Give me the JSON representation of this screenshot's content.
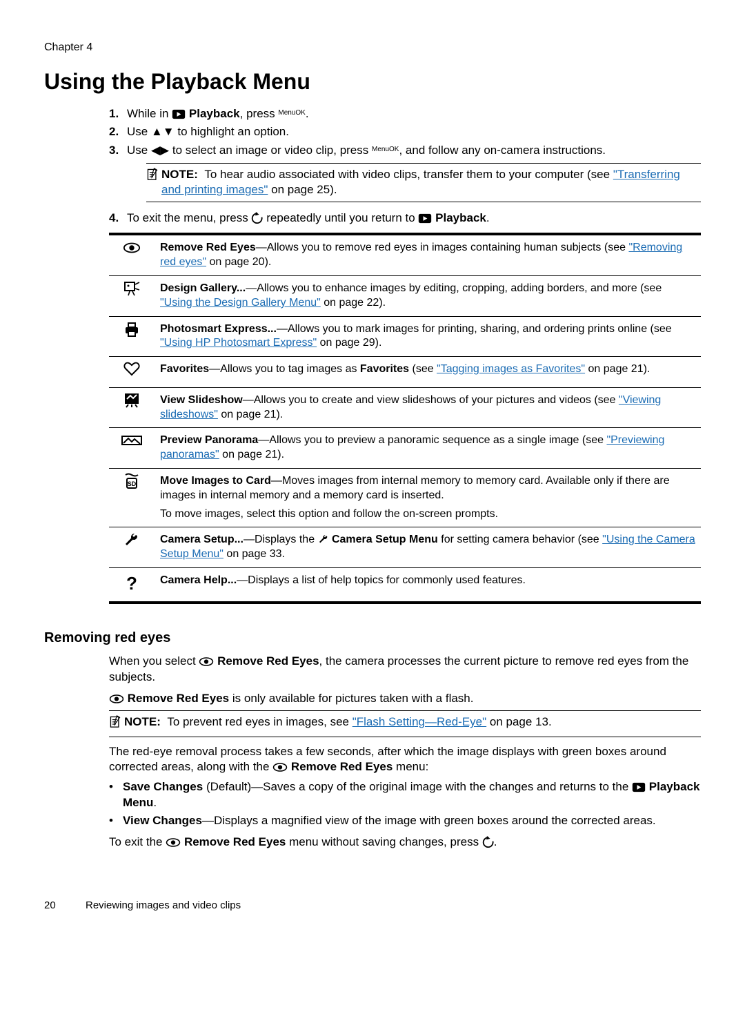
{
  "chapter": "Chapter 4",
  "title": "Using the Playback Menu",
  "steps": [
    {
      "num": "1.",
      "pre": "While in ",
      "icon": "playback-icon",
      "bold": " Playback",
      "post": ", press ",
      "end_icon": "menu-ok",
      "suffix": "."
    },
    {
      "num": "2.",
      "pre": "Use ",
      "icon": "up-down-icon",
      "post": " to highlight an option."
    },
    {
      "num": "3.",
      "pre": "Use ",
      "icon": "left-right-icon",
      "post": " to select an image or video clip, press ",
      "end_icon": "menu-ok",
      "suffix": ", and follow any on-camera instructions."
    }
  ],
  "note1": {
    "label": "NOTE:",
    "text": "To hear audio associated with video clips, transfer them to your computer (see ",
    "link": "\"Transferring and printing images\"",
    "after": " on page 25)."
  },
  "step4": {
    "num": "4.",
    "pre": "To exit the menu, press ",
    "icon": "back-icon",
    "mid": " repeatedly until you return to ",
    "icon2": "playback-icon",
    "bold": " Playback",
    "post": "."
  },
  "rows": [
    {
      "icon": "eye-icon",
      "bold": "Remove Red Eyes",
      "dash": "—Allows you to remove red eyes in images containing human subjects (see ",
      "link": "\"Removing red eyes\"",
      "after": " on page 20)."
    },
    {
      "icon": "design-gallery-icon",
      "bold": "Design Gallery...",
      "dash": "—Allows you to enhance images by editing, cropping, adding borders, and more (see ",
      "link": "\"Using the Design Gallery Menu\"",
      "after": " on page 22)."
    },
    {
      "icon": "photosmart-icon",
      "bold": "Photosmart Express...",
      "dash": "—Allows you to mark images for printing, sharing, and ordering prints online (see ",
      "link": "\"Using HP Photosmart Express\"",
      "after": " on page 29)."
    },
    {
      "icon": "heart-icon",
      "bold": "Favorites",
      "dash": "—Allows you to tag images as ",
      "bold2": "Favorites",
      "mid": " (see ",
      "link": "\"Tagging images as Favorites\"",
      "after": " on page 21)."
    },
    {
      "icon": "slideshow-icon",
      "bold": "View Slideshow",
      "dash": "—Allows you to create and view slideshows of your pictures and videos (see ",
      "link": "\"Viewing slideshows\"",
      "after": " on page 21)."
    },
    {
      "icon": "panorama-icon",
      "bold": "Preview Panorama",
      "dash": "—Allows you to preview a panoramic sequence as a single image (see ",
      "link": "\"Previewing panoramas\"",
      "after": " on page 21)."
    },
    {
      "icon": "sd-card-icon",
      "bold": "Move Images to Card",
      "dash": "—Moves images from internal memory to memory card. Available only if there are images in internal memory and a memory card is inserted.",
      "line2": "To move images, select this option and follow the on-screen prompts."
    },
    {
      "icon": "wrench-icon",
      "bold": "Camera Setup...",
      "dash": "—Displays the ",
      "inline_icon": "wrench-icon",
      "bold2": " Camera Setup Menu",
      "mid": " for setting camera behavior (see ",
      "link": "\"Using the Camera Setup Menu\"",
      "after": " on page 33."
    },
    {
      "icon": "help-icon",
      "bold": "Camera Help...",
      "dash": "—Displays a list of help topics for commonly used features."
    }
  ],
  "sub_heading": "Removing red eyes",
  "sub_p1": {
    "pre": "When you select ",
    "icon": "eye-icon",
    "bold": " Remove Red Eyes",
    "post": ", the camera processes the current picture to remove red eyes from the subjects."
  },
  "sub_p2": {
    "icon": "eye-icon",
    "bold": " Remove Red Eyes",
    "post": " is only available for pictures taken with a flash."
  },
  "note2": {
    "label": "NOTE:",
    "text": "To prevent red eyes in images, see ",
    "link": "\"Flash Setting—Red-Eye\"",
    "after": " on page 13."
  },
  "sub_p3": {
    "pre": "The red-eye removal process takes a few seconds, after which the image displays with green boxes around corrected areas, along with the ",
    "icon": "eye-icon",
    "bold": " Remove Red Eyes",
    "post": " menu:"
  },
  "sub_bullets": [
    {
      "bold": "Save Changes",
      "text1": " (Default)—Saves a copy of the original image with the changes and returns to the ",
      "icon": "playback-icon",
      "bold2": " Playback Menu",
      "text2": "."
    },
    {
      "bold": "View Changes",
      "text1": "—Displays a magnified view of the image with green boxes around the corrected areas."
    }
  ],
  "sub_p4": {
    "pre": "To exit the ",
    "icon": "eye-icon",
    "bold": " Remove Red Eyes",
    "mid": " menu without saving changes, press ",
    "icon2": "back-icon",
    "post": "."
  },
  "footer": {
    "page": "20",
    "caption": "Reviewing images and video clips"
  }
}
